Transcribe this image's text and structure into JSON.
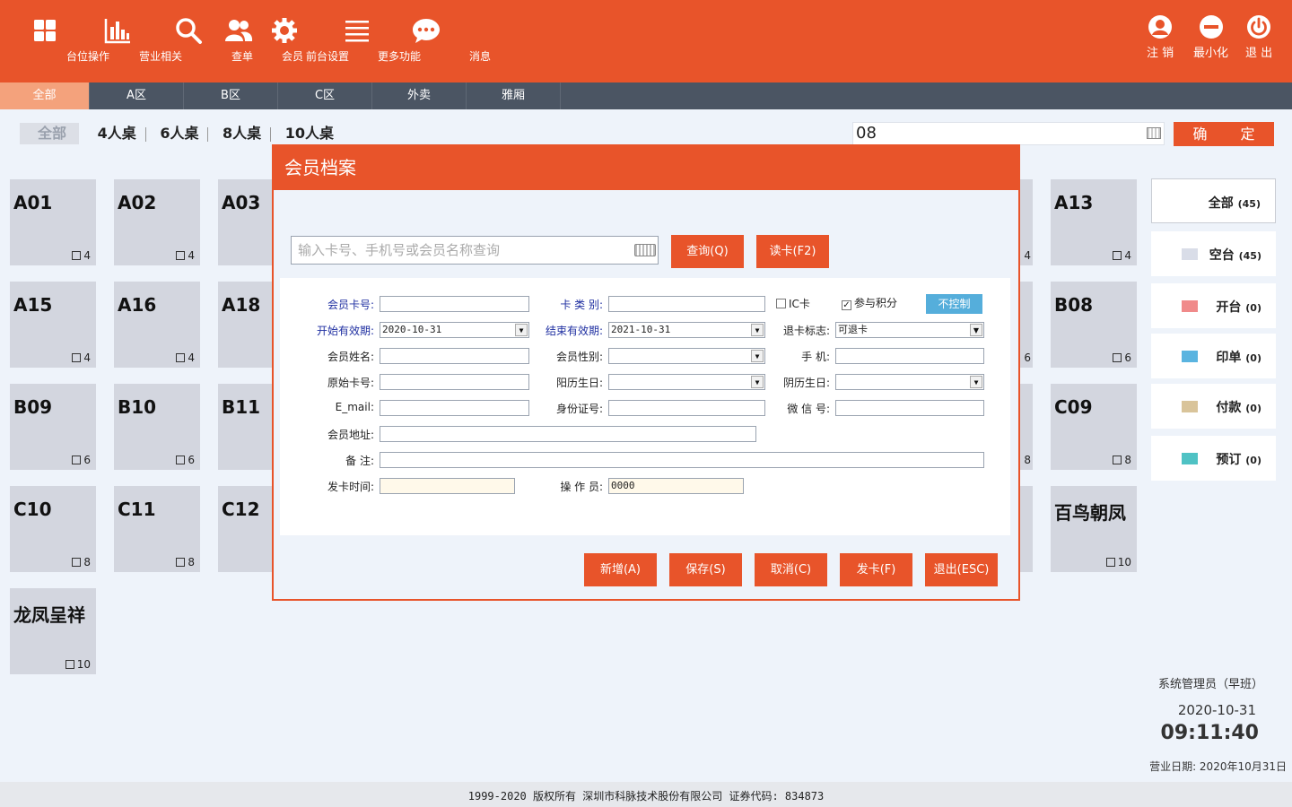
{
  "nav": {
    "items": [
      {
        "label": "台位操作",
        "icon": "grid-icon"
      },
      {
        "label": "营业相关",
        "icon": "bar-chart-icon"
      },
      {
        "label": "查单",
        "icon": "search-icon"
      },
      {
        "label": "会员",
        "icon": "users-icon"
      },
      {
        "label": "前台设置",
        "icon": "gear-icon"
      },
      {
        "label": "更多功能",
        "icon": "menu-icon"
      },
      {
        "label": "消息",
        "icon": "message-icon"
      }
    ],
    "right": [
      {
        "label": "注 销",
        "icon": "user-logout-icon"
      },
      {
        "label": "最小化",
        "icon": "minimize-icon"
      },
      {
        "label": "退 出",
        "icon": "power-icon"
      }
    ]
  },
  "zones": [
    "全部",
    "A区",
    "B区",
    "C区",
    "外卖",
    "雅厢"
  ],
  "seat_filters": [
    "全部",
    "4人桌",
    "6人桌",
    "8人桌",
    "10人桌"
  ],
  "top_search": {
    "value": "08"
  },
  "confirm_label": "确 定",
  "tables": [
    {
      "name": "A01",
      "seats": "4"
    },
    {
      "name": "A02",
      "seats": "4"
    },
    {
      "name": "A03",
      "seats": ""
    },
    {
      "name": "A13",
      "seats": "4"
    },
    {
      "name": "A15",
      "seats": "4"
    },
    {
      "name": "A16",
      "seats": "4"
    },
    {
      "name": "A18",
      "seats": ""
    },
    {
      "name": "B08",
      "seats": "6"
    },
    {
      "name": "B09",
      "seats": "6"
    },
    {
      "name": "B10",
      "seats": "6"
    },
    {
      "name": "B11",
      "seats": ""
    },
    {
      "name": "C09",
      "seats": "8"
    },
    {
      "name": "C10",
      "seats": "8"
    },
    {
      "name": "C11",
      "seats": "8"
    },
    {
      "name": "C12",
      "seats": ""
    },
    {
      "name": "百鸟朝凤",
      "seats": "10"
    },
    {
      "name": "龙凤呈祥",
      "seats": "10"
    }
  ],
  "partial_seats": [
    "4",
    "6",
    "8"
  ],
  "status": [
    {
      "label": "全部",
      "count": "(45)",
      "color": ""
    },
    {
      "label": "空台",
      "count": "(45)",
      "color": "#d9dde8"
    },
    {
      "label": "开台",
      "count": "(0)",
      "color": "#f08a8a"
    },
    {
      "label": "印单",
      "count": "(0)",
      "color": "#5ab4e0"
    },
    {
      "label": "付款",
      "count": "(0)",
      "color": "#d9c49a"
    },
    {
      "label": "预订",
      "count": "(0)",
      "color": "#4fc2c4"
    }
  ],
  "info": {
    "operator": "系统管理员（早班）",
    "date": "2020-10-31",
    "time": "09:11:40",
    "business_date": "营业日期: 2020年10月31日"
  },
  "footer": "1999-2020  版权所有  深圳市科脉技术股份有限公司  证券代码: 834873",
  "modal": {
    "title": "会员档案",
    "search_placeholder": "输入卡号、手机号或会员名称查询",
    "query_btn": "查询(Q)",
    "read_card_btn": "读卡(F2)",
    "labels": {
      "card_no": "会员卡号:",
      "card_type": "卡 类 别:",
      "ic_card": "IC卡",
      "points": "参与积分",
      "no_control": "不控制",
      "start_date": "开始有效期:",
      "end_date": "结束有效期:",
      "refund_flag": "退卡标志:",
      "name": "会员姓名:",
      "gender": "会员性别:",
      "mobile": "手    机:",
      "orig_card": "原始卡号:",
      "solar_birthday": "阳历生日:",
      "lunar_birthday": "阴历生日:",
      "email": "E_mail:",
      "id_card": "身份证号:",
      "wechat": "微 信 号:",
      "address": "会员地址:",
      "remark": "备    注:",
      "issue_time": "发卡时间:",
      "operator": "操 作 员:"
    },
    "values": {
      "start_date": "2020-10-31",
      "end_date": "2021-10-31",
      "refund_flag": "可退卡",
      "operator": "0000"
    },
    "buttons": [
      "新增(A)",
      "保存(S)",
      "取消(C)",
      "发卡(F)",
      "退出(ESC)"
    ]
  }
}
